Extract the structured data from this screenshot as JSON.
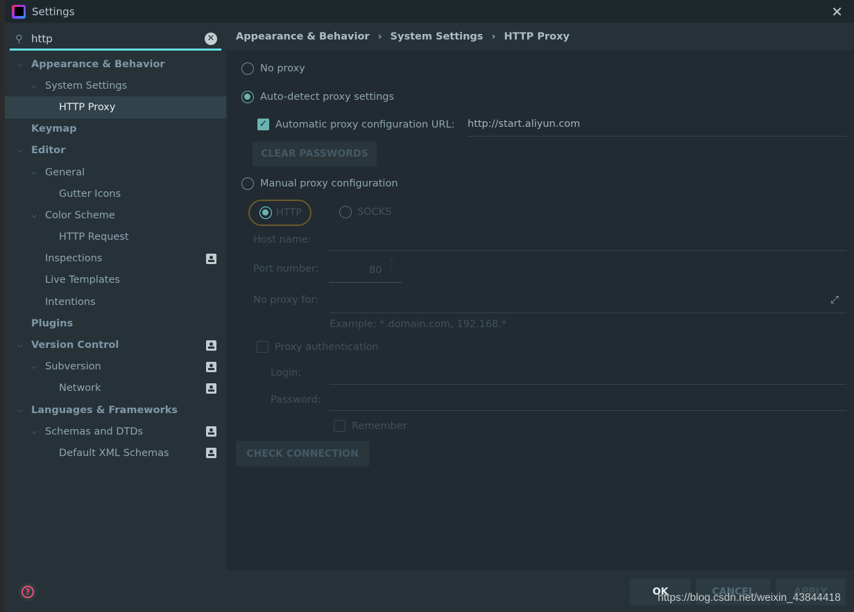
{
  "window": {
    "title": "Settings",
    "close_icon": "close-icon"
  },
  "search": {
    "value": "http",
    "icon": "search-icon",
    "clear_icon": "clear-icon",
    "accent": "#68e0e6"
  },
  "tree": [
    {
      "label": "Appearance & Behavior",
      "level": 0,
      "bold": true,
      "expanded": true
    },
    {
      "label": "System Settings",
      "level": 1,
      "expanded": true
    },
    {
      "label": "HTTP Proxy",
      "level": 2,
      "selected": true
    },
    {
      "label": "Keymap",
      "level": 0,
      "bold": true
    },
    {
      "label": "Editor",
      "level": 0,
      "bold": true,
      "expanded": true
    },
    {
      "label": "General",
      "level": 1,
      "expanded": true
    },
    {
      "label": "Gutter Icons",
      "level": 2
    },
    {
      "label": "Color Scheme",
      "level": 1,
      "expanded": true
    },
    {
      "label": "HTTP Request",
      "level": 2
    },
    {
      "label": "Inspections",
      "level": 1,
      "profile": true
    },
    {
      "label": "Live Templates",
      "level": 1
    },
    {
      "label": "Intentions",
      "level": 1
    },
    {
      "label": "Plugins",
      "level": 0,
      "bold": true
    },
    {
      "label": "Version Control",
      "level": 0,
      "bold": true,
      "expanded": true,
      "profile": true
    },
    {
      "label": "Subversion",
      "level": 1,
      "expanded": true,
      "profile": true
    },
    {
      "label": "Network",
      "level": 2,
      "profile": true
    },
    {
      "label": "Languages & Frameworks",
      "level": 0,
      "bold": true,
      "expanded": true
    },
    {
      "label": "Schemas and DTDs",
      "level": 1,
      "expanded": true,
      "profile": true
    },
    {
      "label": "Default XML Schemas",
      "level": 2,
      "profile": true
    }
  ],
  "breadcrumb": [
    "Appearance & Behavior",
    "System Settings",
    "HTTP Proxy"
  ],
  "proxy": {
    "no_proxy": "No proxy",
    "auto_detect": "Auto-detect proxy settings",
    "auto_url_label": "Automatic proxy configuration URL:",
    "auto_url_value": "http://start.aliyun.com",
    "auto_url_checked": true,
    "clear_passwords": "CLEAR PASSWORDS",
    "manual": "Manual proxy configuration",
    "selected_mode": "auto_detect",
    "http": "HTTP",
    "socks": "SOCKS",
    "host_label": "Host name:",
    "port_label": "Port number:",
    "port_value": "80",
    "no_proxy_for_label": "No proxy for:",
    "example": "Example: *.domain.com, 192.168.*",
    "proxy_auth": "Proxy authentication",
    "login_label": "Login:",
    "password_label": "Password:",
    "remember": "Remember",
    "check_connection": "CHECK CONNECTION"
  },
  "footer": {
    "ok": "OK",
    "cancel": "CANCEL",
    "apply": "APPLY",
    "watermark": "https://blog.csdn.net/weixin_43844418"
  },
  "colors": {
    "accent": "#6ab4b0",
    "help": "#f0506e"
  }
}
